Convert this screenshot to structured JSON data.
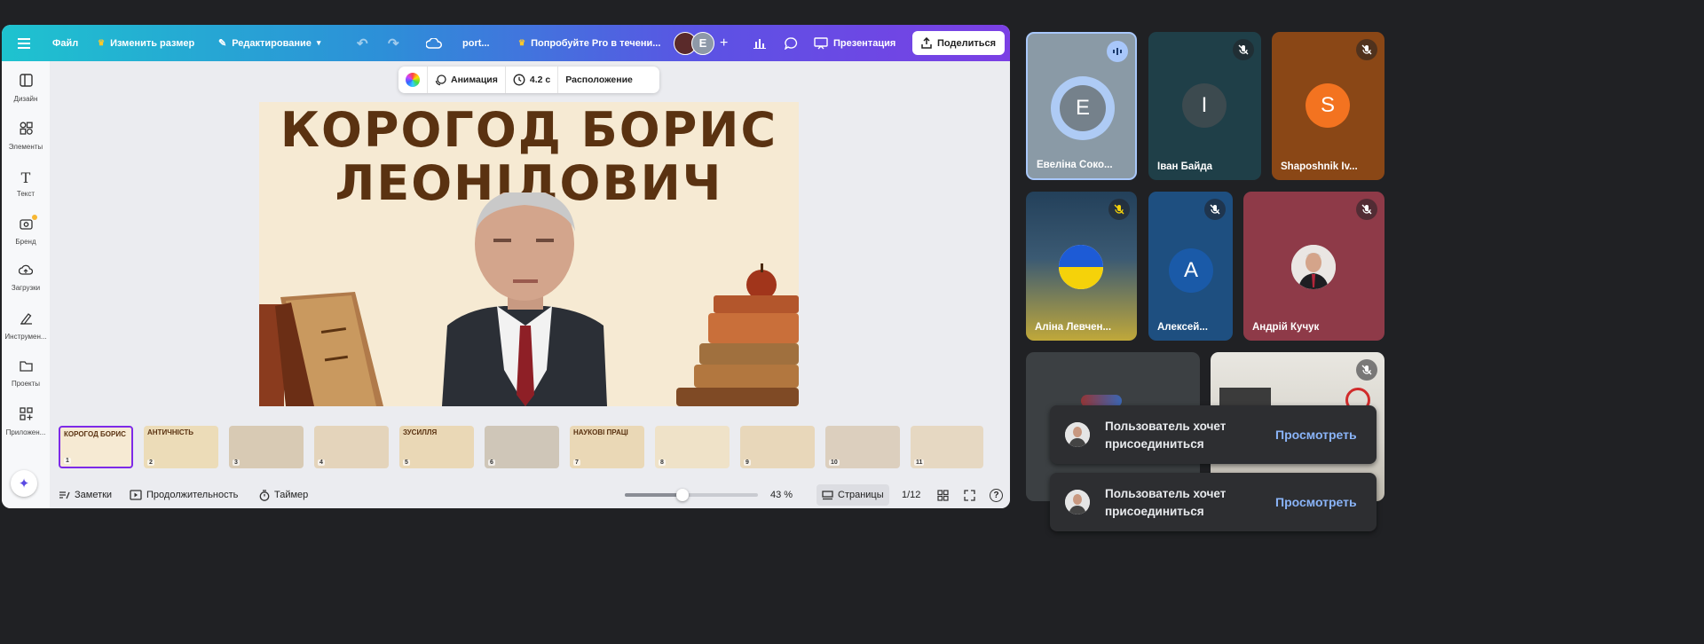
{
  "topbar": {
    "file": "Файл",
    "resize": "Изменить размер",
    "edit": "Редактирование",
    "doc_title": "port...",
    "try_pro": "Попробуйте Pro в течени...",
    "avatar_letter": "E",
    "presentation": "Презентация",
    "share": "Поделиться"
  },
  "sidebar": {
    "items": [
      {
        "label": "Дизайн",
        "icon": "layout-icon"
      },
      {
        "label": "Элементы",
        "icon": "shapes-icon"
      },
      {
        "label": "Текст",
        "icon": "text-icon"
      },
      {
        "label": "Бренд",
        "icon": "brand-icon"
      },
      {
        "label": "Загрузки",
        "icon": "upload-cloud-icon"
      },
      {
        "label": "Инструмен...",
        "icon": "pen-icon"
      },
      {
        "label": "Проекты",
        "icon": "folder-icon"
      },
      {
        "label": "Приложен...",
        "icon": "apps-icon"
      }
    ]
  },
  "context_toolbar": {
    "animation": "Анимация",
    "duration": "4.2 с",
    "position": "Расположение"
  },
  "slide": {
    "title_line1": "КОРОГОД БОРИС",
    "title_line2": "ЛЕОНІДОВИЧ"
  },
  "thumbnails": [
    {
      "label": "КОРОГОД БОРИС",
      "num": "1"
    },
    {
      "label": "АНТИЧНІСТЬ",
      "num": "2"
    },
    {
      "label": "",
      "num": "3"
    },
    {
      "label": "",
      "num": "4"
    },
    {
      "label": "ЗУСИЛЛЯ",
      "num": "5"
    },
    {
      "label": "",
      "num": "6"
    },
    {
      "label": "НАУКОВІ ПРАЦІ",
      "num": "7"
    },
    {
      "label": "",
      "num": "8"
    },
    {
      "label": "",
      "num": "9"
    },
    {
      "label": "",
      "num": "10"
    },
    {
      "label": "",
      "num": "11"
    }
  ],
  "bottombar": {
    "notes": "Заметки",
    "duration": "Продолжительность",
    "timer": "Таймер",
    "zoom": "43 %",
    "zoom_value": 0.43,
    "pages": "Страницы",
    "page_count": "1/12"
  },
  "participants": [
    {
      "name": "Евеліна Соко...",
      "initial": "E",
      "speaking": true
    },
    {
      "name": "Іван Байда",
      "initial": "I",
      "muted": true
    },
    {
      "name": "Shaposhnik Iv...",
      "initial": "S",
      "muted": true
    },
    {
      "name": "Аліна Левчен...",
      "initial": "",
      "muted": true
    },
    {
      "name": "Алексей...",
      "initial": "A",
      "muted": true
    },
    {
      "name": "Андрій Кучук",
      "initial": "",
      "muted": true
    }
  ],
  "notifications": [
    {
      "text": "Пользователь хочет присоединиться",
      "action": "Просмотреть"
    },
    {
      "text": "Пользователь хочет присоединиться",
      "action": "Просмотреть"
    }
  ],
  "colors": {
    "canva_gradient_start": "#1ec3cf",
    "canva_gradient_end": "#7b3fe4",
    "meet_background": "#202124",
    "link_blue": "#8ab4f8",
    "title_brown": "#5a3211"
  }
}
